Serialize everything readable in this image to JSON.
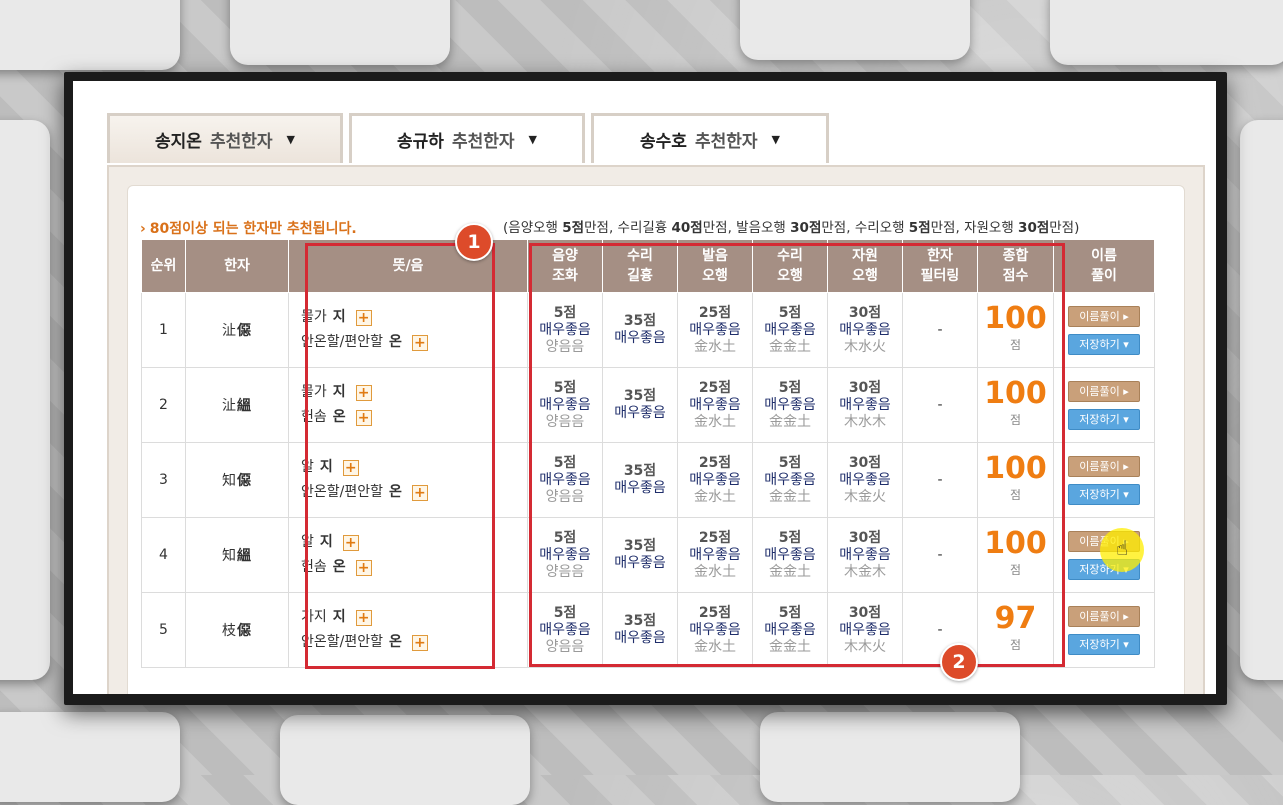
{
  "tabs": [
    {
      "name": "송지온",
      "suffix": "추천한자",
      "active": true
    },
    {
      "name": "송규하",
      "suffix": "추천한자",
      "active": false
    },
    {
      "name": "송수호",
      "suffix": "추천한자",
      "active": false
    }
  ],
  "notice": "80점이상 되는 한자만 추천됩니다.",
  "criteria": {
    "open": "(",
    "items": [
      {
        "label": "음양오행 ",
        "score": "5점",
        "tail": "만점"
      },
      {
        "label": "수리길흉 ",
        "score": "40점",
        "tail": "만점"
      },
      {
        "label": "발음오행 ",
        "score": "30점",
        "tail": "만점"
      },
      {
        "label": "수리오행 ",
        "score": "5점",
        "tail": "만점"
      },
      {
        "label": "자원오행 ",
        "score": "30점",
        "tail": "만점"
      }
    ],
    "sep": ", ",
    "close": ")"
  },
  "headers": {
    "rank": "순위",
    "hanja": "한자",
    "meaning": "뜻/음",
    "yinyang": [
      "음양",
      "조화"
    ],
    "suri": [
      "수리",
      "길흉"
    ],
    "pron": [
      "발음",
      "오행"
    ],
    "suri_ohaeng": [
      "수리",
      "오행"
    ],
    "jawon": [
      "자원",
      "오행"
    ],
    "filter": [
      "한자",
      "필터링"
    ],
    "total": [
      "종합",
      "점수"
    ],
    "name_explain": [
      "이름",
      "풀이"
    ]
  },
  "rows": [
    {
      "rank": "1",
      "h1": "沚",
      "h2": "僫",
      "m1": "물가",
      "r1": "지",
      "m2": "안온할/편안할",
      "r2": "온",
      "s1": [
        "5점",
        "매우좋음",
        "양음음"
      ],
      "s2": [
        "35점",
        "매우좋음",
        ""
      ],
      "s3": [
        "25점",
        "매우좋음",
        "金水土"
      ],
      "s4": [
        "5점",
        "매우좋음",
        "金金土"
      ],
      "s5": [
        "30점",
        "매우좋음",
        "木水火"
      ],
      "filter": "-",
      "total": "100",
      "unit": "점"
    },
    {
      "rank": "2",
      "h1": "沚",
      "h2": "縕",
      "m1": "물가",
      "r1": "지",
      "m2": "헌솜",
      "r2": "온",
      "s1": [
        "5점",
        "매우좋음",
        "양음음"
      ],
      "s2": [
        "35점",
        "매우좋음",
        ""
      ],
      "s3": [
        "25점",
        "매우좋음",
        "金水土"
      ],
      "s4": [
        "5점",
        "매우좋음",
        "金金土"
      ],
      "s5": [
        "30점",
        "매우좋음",
        "木水木"
      ],
      "filter": "-",
      "total": "100",
      "unit": "점"
    },
    {
      "rank": "3",
      "h1": "知",
      "h2": "僫",
      "m1": "알",
      "r1": "지",
      "m2": "안온할/편안할",
      "r2": "온",
      "s1": [
        "5점",
        "매우좋음",
        "양음음"
      ],
      "s2": [
        "35점",
        "매우좋음",
        ""
      ],
      "s3": [
        "25점",
        "매우좋음",
        "金水土"
      ],
      "s4": [
        "5점",
        "매우좋음",
        "金金土"
      ],
      "s5": [
        "30점",
        "매우좋음",
        "木金火"
      ],
      "filter": "-",
      "total": "100",
      "unit": "점"
    },
    {
      "rank": "4",
      "h1": "知",
      "h2": "縕",
      "m1": "알",
      "r1": "지",
      "m2": "헌솜",
      "r2": "온",
      "s1": [
        "5점",
        "매우좋음",
        "양음음"
      ],
      "s2": [
        "35점",
        "매우좋음",
        ""
      ],
      "s3": [
        "25점",
        "매우좋음",
        "金水土"
      ],
      "s4": [
        "5점",
        "매우좋음",
        "金金土"
      ],
      "s5": [
        "30점",
        "매우좋음",
        "木金木"
      ],
      "filter": "-",
      "total": "100",
      "unit": "점"
    },
    {
      "rank": "5",
      "h1": "枝",
      "h2": "僫",
      "m1": "가지",
      "r1": "지",
      "m2": "안온할/편안할",
      "r2": "온",
      "s1": [
        "5점",
        "매우좋음",
        "양음음"
      ],
      "s2": [
        "35점",
        "매우좋음",
        ""
      ],
      "s3": [
        "25점",
        "매우좋음",
        "金水土"
      ],
      "s4": [
        "5점",
        "매우좋음",
        "金金土"
      ],
      "s5": [
        "30점",
        "매우좋음",
        "木木火"
      ],
      "filter": "-",
      "total": "97",
      "unit": "점"
    }
  ],
  "buttons": {
    "name_explain": "이름풀이 ▸",
    "save": "저장하기 ▾"
  },
  "badges": {
    "one": "1",
    "two": "2"
  },
  "colors": {
    "header_bg": "#a58f84",
    "accent_orange": "#ef7d12",
    "highlight_red": "#d42a33",
    "save_blue": "#5aa6df",
    "explain_tan": "#c9a07a"
  }
}
